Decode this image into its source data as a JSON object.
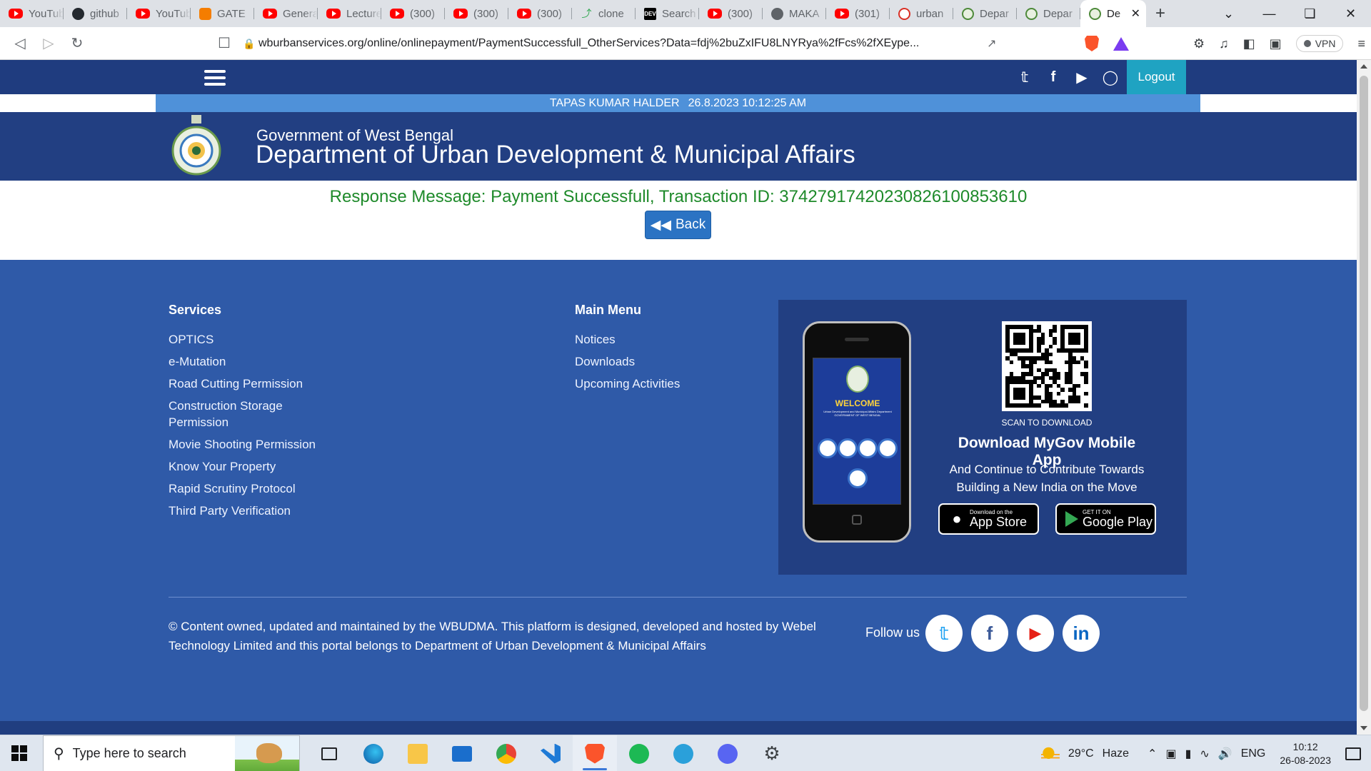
{
  "browser": {
    "tabs": [
      {
        "title": "YouTube",
        "icon": "youtube-icon"
      },
      {
        "title": "github",
        "icon": "github-icon"
      },
      {
        "title": "YouTube",
        "icon": "youtube-icon"
      },
      {
        "title": "GATE",
        "icon": "blogger-icon"
      },
      {
        "title": "General",
        "icon": "youtube-icon"
      },
      {
        "title": "Lecture",
        "icon": "youtube-icon"
      },
      {
        "title": "(300)",
        "icon": "youtube-icon"
      },
      {
        "title": "(300)",
        "icon": "youtube-icon"
      },
      {
        "title": "(300)",
        "icon": "youtube-icon"
      },
      {
        "title": "clone",
        "icon": "clone-icon"
      },
      {
        "title": "Search",
        "icon": "dev-icon"
      },
      {
        "title": "(300)",
        "icon": "youtube-icon"
      },
      {
        "title": "MAKA",
        "icon": "globe-icon"
      },
      {
        "title": "(301)",
        "icon": "youtube-icon"
      },
      {
        "title": "urban",
        "icon": "shield-icon"
      },
      {
        "title": "Depar",
        "icon": "wb-emblem-icon"
      },
      {
        "title": "Depar",
        "icon": "wb-emblem-icon"
      }
    ],
    "active_tab": {
      "title": "De",
      "icon": "wb-emblem-icon"
    },
    "url": "wburbanservices.org/online/onlinepayment/PaymentSuccessfull_OtherServices?Data=fdj%2buZxIFU8LNYRya%2fFcs%2fXEype...",
    "vpn_label": "VPN",
    "dev_icon_text": "DEV"
  },
  "site": {
    "logout_label": "Logout",
    "user_name": "TAPAS KUMAR HALDER",
    "timestamp": "26.8.2023 10:12:25 AM",
    "gov_line": "Government of West Bengal",
    "dept_line": "Department of Urban Development & Municipal Affairs",
    "response_message": "Response Message: Payment Successfull, Transaction ID: 374279174202308261008536​10",
    "back_label": "Back"
  },
  "footer": {
    "services_title": "Services",
    "services": [
      "OPTICS",
      "e-Mutation",
      "Road Cutting Permission",
      "Construction Storage Permission",
      "Movie Shooting Permission",
      "Know Your Property",
      "Rapid Scrutiny Protocol",
      "Third Party Verification"
    ],
    "menu_title": "Main Menu",
    "menu": [
      "Notices",
      "Downloads",
      "Upcoming Activities"
    ],
    "app": {
      "phone_welcome": "WELCOME",
      "phone_sub": "Urban Development and Municipal Affairs Department GOVERNMENT OF WEST BENGAL",
      "scan_text": "SCAN TO DOWNLOAD",
      "title": "Download MyGov Mobile App",
      "subtitle": "And Continue to Contribute Towards Building a New India on the Move",
      "appstore_small": "Download on the",
      "appstore_big": "App Store",
      "playstore_small": "GET IT ON",
      "playstore_big": "Google Play"
    },
    "copyright": "© Content owned, updated and maintained by the WBUDMA. This platform is designed, developed and hosted by Webel Technology Limited and this portal belongs to Department of Urban Development & Municipal Affairs",
    "follow_label": "Follow us"
  },
  "taskbar": {
    "search_placeholder": "Type here to search",
    "temperature": "29°C",
    "weather": "Haze",
    "language": "ENG",
    "time": "10:12",
    "date": "26-08-2023"
  },
  "colors": {
    "nav_bg": "#1f3c7f",
    "user_bar": "#4f91d9",
    "banner_bg": "#223f82",
    "footer_bg": "#2f5aa8",
    "success_text": "#1e8a2a",
    "logout_bg": "#1fa3c2",
    "back_button": "#2b73c3"
  }
}
